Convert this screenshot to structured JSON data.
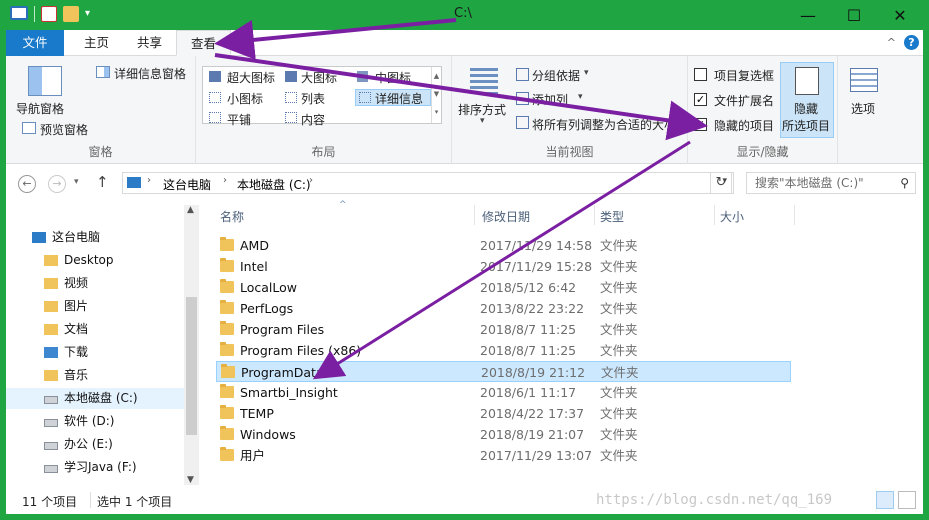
{
  "window": {
    "title": "C:\\",
    "minimize": "—",
    "maximize": "☐",
    "close": "✕"
  },
  "ribbon_tabs": {
    "file": "文件",
    "home": "主页",
    "share": "共享",
    "view": "查看"
  },
  "ribbon": {
    "panes": {
      "group": "窗格",
      "nav_pane": "导航窗格",
      "preview_pane": "预览窗格",
      "details_pane": "详细信息窗格"
    },
    "layout": {
      "group": "布局",
      "extra_large": "超大图标",
      "large": "大图标",
      "medium": "中图标",
      "small": "小图标",
      "list": "列表",
      "details": "详细信息",
      "tiles": "平铺",
      "content": "内容"
    },
    "current_view": {
      "group": "当前视图",
      "sort_by": "排序方式",
      "group_by": "分组依据",
      "add_column": "添加列",
      "fit_columns": "将所有列调整为合适的大小"
    },
    "show_hide": {
      "group": "显示/隐藏",
      "item_checkboxes": "项目复选框",
      "item_checkboxes_checked": false,
      "file_extensions": "文件扩展名",
      "file_extensions_checked": true,
      "hidden_items": "隐藏的项目",
      "hidden_items_checked": true,
      "hide_selected_line1": "隐藏",
      "hide_selected_line2": "所选项目"
    },
    "options": "选项"
  },
  "address": {
    "path": [
      "这台电脑",
      "本地磁盘 (C:)"
    ],
    "search_placeholder": "搜索\"本地磁盘 (C:)\""
  },
  "nav": {
    "items": [
      {
        "label": "这台电脑",
        "icon": "computer-icon"
      },
      {
        "label": "Desktop",
        "icon": "folder-icon"
      },
      {
        "label": "视频",
        "icon": "folder-icon"
      },
      {
        "label": "图片",
        "icon": "folder-icon"
      },
      {
        "label": "文档",
        "icon": "folder-icon"
      },
      {
        "label": "下载",
        "icon": "download-folder-icon"
      },
      {
        "label": "音乐",
        "icon": "folder-icon"
      },
      {
        "label": "本地磁盘 (C:)",
        "icon": "drive-icon"
      },
      {
        "label": "软件 (D:)",
        "icon": "drive-icon"
      },
      {
        "label": "办公 (E:)",
        "icon": "drive-icon"
      },
      {
        "label": "学习Java (F:)",
        "icon": "drive-icon"
      }
    ]
  },
  "columns": {
    "name": "名称",
    "date": "修改日期",
    "type": "类型",
    "size": "大小"
  },
  "files": [
    {
      "name": "AMD",
      "date": "2017/11/29 14:58",
      "type": "文件夹"
    },
    {
      "name": "Intel",
      "date": "2017/11/29 15:28",
      "type": "文件夹"
    },
    {
      "name": "LocalLow",
      "date": "2018/5/12 6:42",
      "type": "文件夹"
    },
    {
      "name": "PerfLogs",
      "date": "2013/8/22 23:22",
      "type": "文件夹"
    },
    {
      "name": "Program Files",
      "date": "2018/8/7 11:25",
      "type": "文件夹"
    },
    {
      "name": "Program Files (x86)",
      "date": "2018/8/7 11:25",
      "type": "文件夹"
    },
    {
      "name": "ProgramData",
      "date": "2018/8/19 21:12",
      "type": "文件夹"
    },
    {
      "name": "Smartbi_Insight",
      "date": "2018/6/1 11:17",
      "type": "文件夹"
    },
    {
      "name": "TEMP",
      "date": "2018/4/22 17:37",
      "type": "文件夹"
    },
    {
      "name": "Windows",
      "date": "2018/8/19 21:07",
      "type": "文件夹"
    },
    {
      "name": "用户",
      "date": "2017/11/29 13:07",
      "type": "文件夹"
    }
  ],
  "selected_index": 6,
  "status": {
    "count": "11 个项目",
    "selected": "选中 1 个项目",
    "watermark": "https://blog.csdn.net/qq_169"
  },
  "colors": {
    "title_bar": "#1fa542",
    "file_tab": "#1979ca",
    "selection": "#cce8ff",
    "annotation_arrow": "#7b1fa2"
  }
}
